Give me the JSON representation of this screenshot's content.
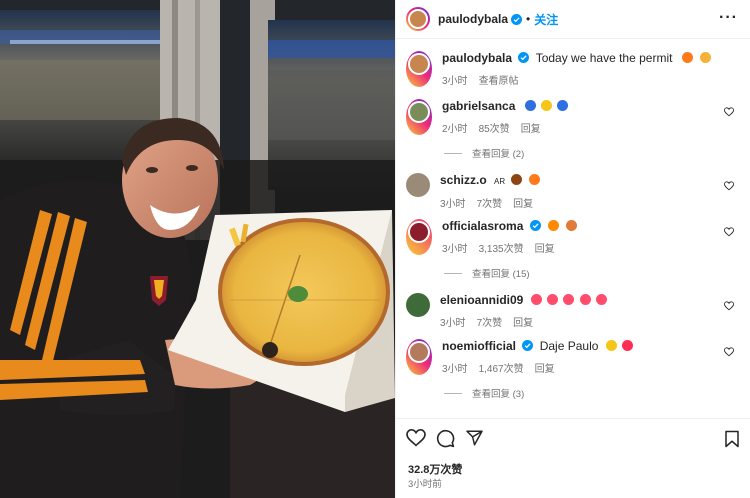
{
  "post": {
    "username": "paulodybala",
    "separator": "•",
    "follow_label": "关注",
    "more_label": "···",
    "caption_text": "Today we have the permit",
    "caption_time": "3小时",
    "caption_translate": "查看原帖"
  },
  "comments": [
    {
      "username": "gabrielsanca",
      "text": "",
      "time": "2小时",
      "likes": "85次赞",
      "reply": "回复",
      "view_replies": "查看回复 (2)",
      "verified": false,
      "emoji_colors": [
        "#2f6fe0",
        "#f5c518",
        "#2f6fe0"
      ]
    },
    {
      "username": "schizz.o",
      "badge": "AR",
      "text": "",
      "time": "3小时",
      "likes": "7次赞",
      "reply": "回复",
      "verified": false,
      "emoji_colors": [
        "#8b4513",
        "#ff7a1a"
      ]
    },
    {
      "username": "officialasroma",
      "text": "",
      "time": "3小时",
      "likes": "3,135次赞",
      "reply": "回复",
      "view_replies": "查看回复 (15)",
      "verified": true,
      "emoji_colors": [
        "#ff8a00",
        "#e07b39"
      ]
    },
    {
      "username": "elenioannidi09",
      "text": "",
      "time": "3小时",
      "likes": "7次赞",
      "reply": "回复",
      "verified": false,
      "emoji_colors": [
        "#ff4d6d",
        "#ff4d6d",
        "#ff4d6d",
        "#ff4d6d",
        "#ff4d6d"
      ]
    },
    {
      "username": "noemiofficial",
      "text": "Daje Paulo",
      "time": "3小时",
      "likes": "1,467次赞",
      "reply": "回复",
      "view_replies": "查看回复 (3)",
      "verified": true,
      "emoji_colors": [
        "#f5c518",
        "#ff2d55"
      ]
    }
  ],
  "footer": {
    "likes_count": "32.8万次赞",
    "posted_time": "3小时前"
  },
  "colors": {
    "accent_blue": "#0095f6",
    "verified_blue": "#0095f6",
    "muted_text": "#737373"
  },
  "icons": [
    "more-icon",
    "verified-icon",
    "heart-icon",
    "comment-icon",
    "share-icon",
    "save-icon"
  ]
}
